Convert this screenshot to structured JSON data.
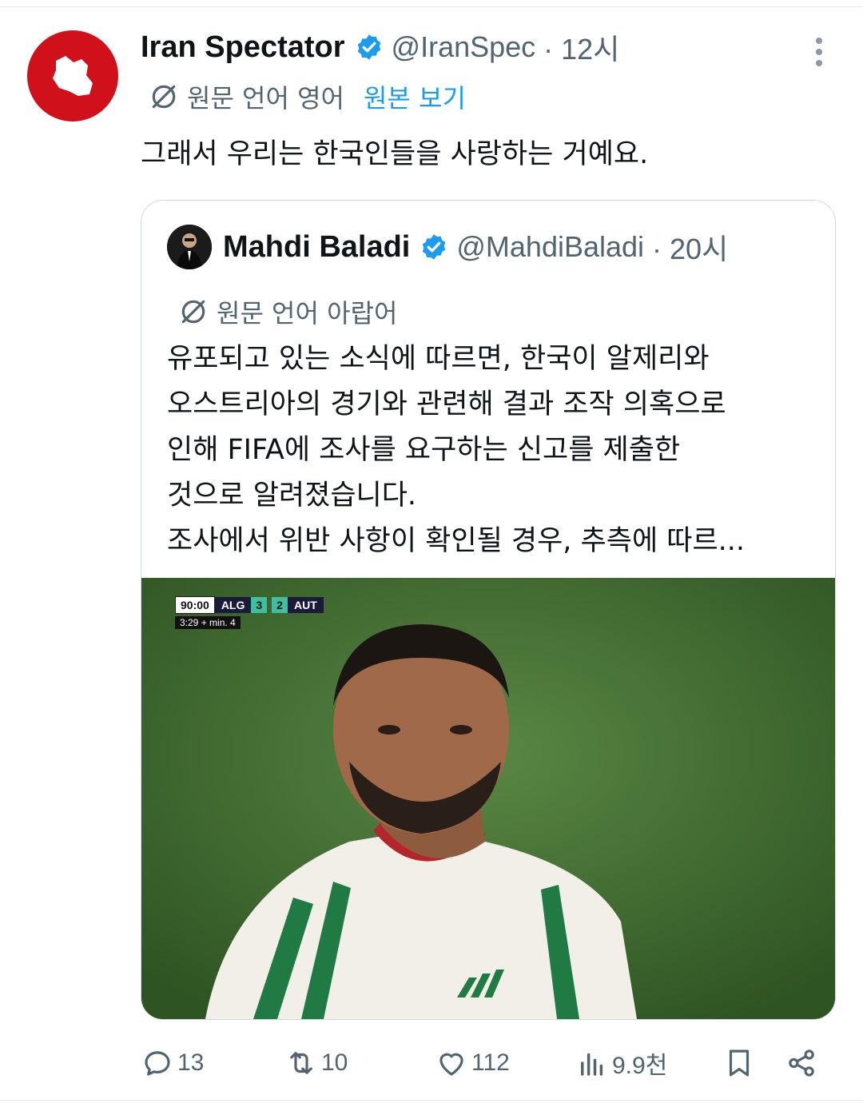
{
  "tweet": {
    "author_name": "Iran Spectator",
    "author_handle": "@IranSpec",
    "time": "· 12시",
    "translate_label": "원문 언어 영어",
    "show_original": "원본 보기",
    "text": "그래서 우리는 한국인들을 사랑하는 거예요."
  },
  "quote": {
    "author_name": "Mahdi Baladi",
    "author_handle": "@MahdiBaladi",
    "time": "· 20시",
    "translate_label": "원문 언어 아랍어",
    "text_lines": [
      "유포되고 있는 소식에 따르면, 한국이 알제리와",
      "오스트리아의 경기와 관련해 결과 조작 의혹으로",
      "인해 FIFA에 조사를 요구하는 신고를 제출한",
      "것으로 알려졌습니다.",
      "조사에서 위반 사항이 확인될 경우, 추측에 따르..."
    ],
    "scorebug": {
      "clock": "90:00",
      "team_home": "ALG",
      "score_home": "3",
      "score_away": "2",
      "team_away": "AUT",
      "extra": "3:29 + min. 4"
    }
  },
  "actions": {
    "replies": "13",
    "retweets": "10",
    "likes": "112",
    "views": "9.9천"
  },
  "colors": {
    "accent": "#1d9bf0",
    "text": "#0f1419",
    "muted": "#536471",
    "avatar_red": "#d0101a"
  },
  "icons": [
    "verified-badge-icon",
    "more-dots-icon",
    "translate-icon",
    "reply-icon",
    "retweet-icon",
    "like-icon",
    "views-icon",
    "bookmark-icon",
    "share-icon"
  ]
}
